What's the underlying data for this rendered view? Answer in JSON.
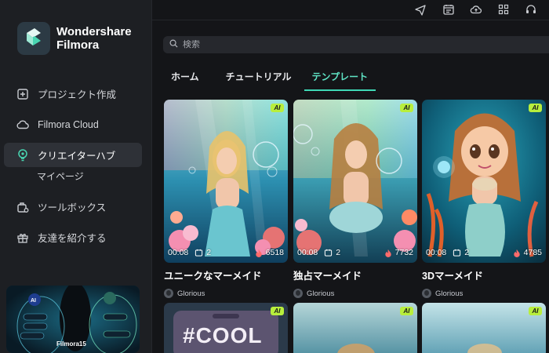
{
  "app": {
    "brand_line1": "Wondershare",
    "brand_line2": "Filmora"
  },
  "sidebar": {
    "items": [
      {
        "label": "プロジェクト作成",
        "icon": "plus-square-icon"
      },
      {
        "label": "Filmora Cloud",
        "icon": "cloud-icon"
      },
      {
        "label": "クリエイターハブ",
        "icon": "lightbulb-icon",
        "active": true
      },
      {
        "label": "ツールボックス",
        "icon": "toolbox-icon"
      },
      {
        "label": "友達を紹介する",
        "icon": "gift-icon"
      }
    ],
    "sub_item": "マイページ",
    "promo_label": "Filmora15"
  },
  "topbar": {
    "icons": [
      "send-icon",
      "calendar-task-icon",
      "cloud-upload-icon",
      "grid-apps-icon",
      "headset-icon"
    ]
  },
  "search": {
    "placeholder": "検索"
  },
  "tabs": [
    {
      "label": "ホーム"
    },
    {
      "label": "チュートリアル"
    },
    {
      "label": "テンプレート",
      "active": true
    }
  ],
  "colors": {
    "accent": "#3fd8b5",
    "ai_badge": "#b8ee3c",
    "sidebar_bg": "#1d1f23",
    "page_bg": "#141518"
  },
  "cards": [
    {
      "title": "ユニークなマーメイド",
      "author": "Glorious",
      "duration": "00:08",
      "clips": "2",
      "likes": "6518",
      "badge": "AI"
    },
    {
      "title": "独占マーメイド",
      "author": "Glorious",
      "duration": "00:08",
      "clips": "2",
      "likes": "7732",
      "badge": "AI"
    },
    {
      "title": "3Dマーメイド",
      "author": "Glorious",
      "duration": "00:08",
      "clips": "2",
      "likes": "4785",
      "badge": "AI"
    }
  ],
  "bottom_cards": [
    {
      "badge": "AI",
      "text": "#COOL"
    },
    {
      "badge": "AI"
    },
    {
      "badge": "AI"
    }
  ]
}
